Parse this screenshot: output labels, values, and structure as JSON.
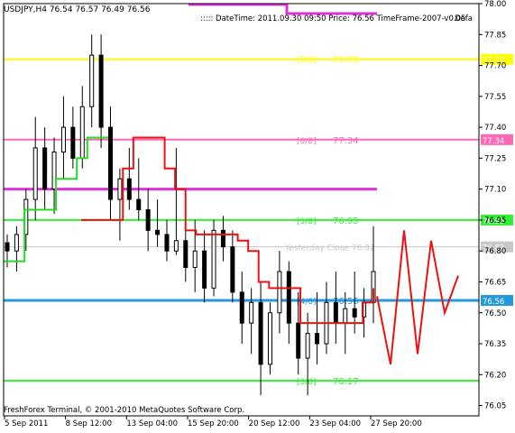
{
  "chart_data": {
    "type": "candlestick",
    "symbol_header": "USDJPY,H4  76.54 76.57 76.49 76.56",
    "info_line": "::::: DateTime: 2011.09.30 09:50    Price: 76.56   TimeFrame-2007-v0.05",
    "info_extra": "Defa",
    "footer": "FreshForex Terminal, © 2001-2010 MetaQuotes Software Corp.",
    "y_ticks": [
      78.0,
      77.85,
      77.7,
      77.55,
      77.4,
      77.25,
      77.1,
      76.95,
      76.8,
      76.65,
      76.5,
      76.35,
      76.2,
      76.05
    ],
    "y_tick_labels": [
      "78.00",
      "77.85",
      "77.70",
      "77.55",
      "77.40",
      "77.25",
      "77.10",
      "76.95",
      "76.80",
      "76.65",
      "76.50",
      "76.35",
      "76.20",
      "76.05"
    ],
    "ylim": [
      76.0,
      78.0
    ],
    "x_tick_labels": [
      "5 Sep 2011",
      "8 Sep 12:00",
      "13 Sep 04:00",
      "15 Sep 20:00",
      "20 Sep 12:00",
      "23 Sep 04:00",
      "27 Sep 20:00"
    ],
    "levels": [
      {
        "name": "7/8",
        "value": 77.73,
        "label": "[7/8]",
        "value_label": "77.73",
        "color": "#ffff00",
        "tag": "77.73"
      },
      {
        "name": "6/8",
        "value": 77.34,
        "label": "[6/8]",
        "value_label": "77.34",
        "color": "#ff69b4",
        "tag": "77.34"
      },
      {
        "name": "murrey-magenta",
        "value": 77.1,
        "label": "",
        "value_label": "",
        "color": "#e030e0",
        "tag": ""
      },
      {
        "name": "5/8",
        "value": 76.95,
        "label": "[5/8]",
        "value_label": "76.95",
        "color": "#33ee33",
        "tag": "76.95"
      },
      {
        "name": "yesterday-close",
        "value": 76.82,
        "label": "Yesterday Close 76.82",
        "value_label": "",
        "color": "#c8c8c8",
        "tag": "76.82"
      },
      {
        "name": "4/8",
        "value": 76.56,
        "label": "[4/8]",
        "value_label": "76.56",
        "color": "#2299dd",
        "tag": "76.56"
      },
      {
        "name": "3/8",
        "value": 76.17,
        "label": "[3/8]",
        "value_label": "76.17",
        "color": "#33ee33",
        "tag": ""
      }
    ],
    "candles": [
      {
        "o": 76.84,
        "h": 76.88,
        "l": 76.72,
        "c": 76.8
      },
      {
        "o": 76.8,
        "h": 76.92,
        "l": 76.7,
        "c": 76.88
      },
      {
        "o": 76.88,
        "h": 77.1,
        "l": 76.8,
        "c": 77.05
      },
      {
        "o": 77.05,
        "h": 77.45,
        "l": 76.95,
        "c": 77.3
      },
      {
        "o": 77.3,
        "h": 77.4,
        "l": 77.0,
        "c": 77.1
      },
      {
        "o": 77.1,
        "h": 77.35,
        "l": 76.98,
        "c": 77.28
      },
      {
        "o": 77.28,
        "h": 77.55,
        "l": 77.15,
        "c": 77.4
      },
      {
        "o": 77.4,
        "h": 77.5,
        "l": 77.2,
        "c": 77.25
      },
      {
        "o": 77.25,
        "h": 77.6,
        "l": 77.2,
        "c": 77.5
      },
      {
        "o": 77.5,
        "h": 77.85,
        "l": 77.4,
        "c": 77.75
      },
      {
        "o": 77.75,
        "h": 77.85,
        "l": 77.3,
        "c": 77.4
      },
      {
        "o": 77.4,
        "h": 77.5,
        "l": 76.95,
        "c": 77.05
      },
      {
        "o": 77.05,
        "h": 77.2,
        "l": 76.85,
        "c": 77.15
      },
      {
        "o": 77.15,
        "h": 77.3,
        "l": 77.0,
        "c": 77.05
      },
      {
        "o": 77.05,
        "h": 77.25,
        "l": 76.95,
        "c": 77.0
      },
      {
        "o": 77.0,
        "h": 77.1,
        "l": 76.8,
        "c": 76.9
      },
      {
        "o": 76.9,
        "h": 77.05,
        "l": 76.82,
        "c": 76.88
      },
      {
        "o": 76.88,
        "h": 76.95,
        "l": 76.75,
        "c": 76.8
      },
      {
        "o": 76.8,
        "h": 77.3,
        "l": 76.78,
        "c": 76.85
      },
      {
        "o": 76.85,
        "h": 76.92,
        "l": 76.65,
        "c": 76.72
      },
      {
        "o": 76.72,
        "h": 76.95,
        "l": 76.6,
        "c": 76.8
      },
      {
        "o": 76.8,
        "h": 76.9,
        "l": 76.55,
        "c": 76.62
      },
      {
        "o": 76.62,
        "h": 76.95,
        "l": 76.58,
        "c": 76.9
      },
      {
        "o": 76.9,
        "h": 76.97,
        "l": 76.75,
        "c": 76.82
      },
      {
        "o": 76.82,
        "h": 76.9,
        "l": 76.55,
        "c": 76.6
      },
      {
        "o": 76.6,
        "h": 76.7,
        "l": 76.35,
        "c": 76.45
      },
      {
        "o": 76.45,
        "h": 76.62,
        "l": 76.3,
        "c": 76.55
      },
      {
        "o": 76.55,
        "h": 76.65,
        "l": 76.1,
        "c": 76.25
      },
      {
        "o": 76.25,
        "h": 76.55,
        "l": 76.2,
        "c": 76.5
      },
      {
        "o": 76.5,
        "h": 76.8,
        "l": 76.4,
        "c": 76.7
      },
      {
        "o": 76.7,
        "h": 76.75,
        "l": 76.35,
        "c": 76.45
      },
      {
        "o": 76.45,
        "h": 76.6,
        "l": 76.2,
        "c": 76.28
      },
      {
        "o": 76.28,
        "h": 76.5,
        "l": 76.1,
        "c": 76.4
      },
      {
        "o": 76.4,
        "h": 76.6,
        "l": 76.25,
        "c": 76.35
      },
      {
        "o": 76.35,
        "h": 76.65,
        "l": 76.3,
        "c": 76.55
      },
      {
        "o": 76.55,
        "h": 76.7,
        "l": 76.35,
        "c": 76.45
      },
      {
        "o": 76.45,
        "h": 76.6,
        "l": 76.3,
        "c": 76.52
      },
      {
        "o": 76.52,
        "h": 76.7,
        "l": 76.4,
        "c": 76.48
      },
      {
        "o": 76.48,
        "h": 76.62,
        "l": 76.38,
        "c": 76.55
      },
      {
        "o": 76.55,
        "h": 76.92,
        "l": 76.45,
        "c": 76.7
      }
    ],
    "red_line": [
      76.95,
      76.95,
      76.95,
      76.95,
      77.2,
      77.35,
      77.35,
      77.35,
      77.2,
      77.1,
      76.9,
      76.88,
      76.88,
      76.88,
      76.88,
      76.85,
      76.8,
      76.65,
      76.62,
      76.62,
      76.62,
      76.45,
      76.45,
      76.45,
      76.45,
      76.45,
      76.45,
      76.55,
      76.62
    ],
    "green_line": [
      76.75,
      76.75,
      77.0,
      77.0,
      77.0,
      77.15,
      77.15,
      77.25,
      77.35,
      77.35,
      77.35
    ],
    "forecast_zigzag": [
      76.58,
      76.25,
      76.9,
      76.3,
      76.85,
      76.5,
      76.68
    ],
    "magenta_top_segments": true
  }
}
